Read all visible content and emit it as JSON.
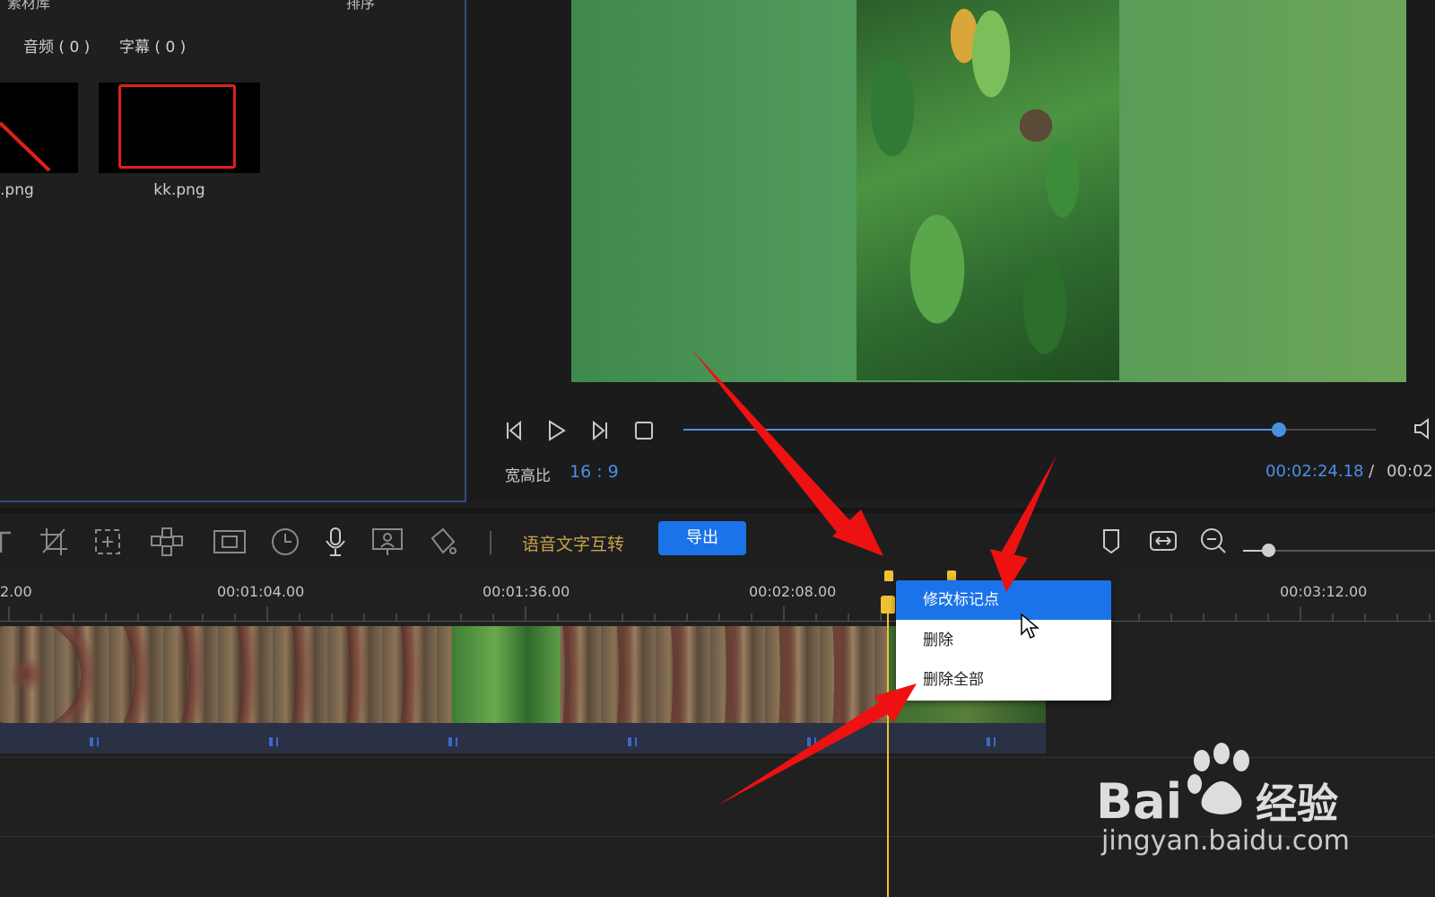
{
  "media": {
    "title": "素材库",
    "sort_label": "排序",
    "tabs": [
      {
        "label": "音频 ( 0 )"
      },
      {
        "label": "字幕 ( 0 )"
      }
    ],
    "items": [
      {
        "name": ".png"
      },
      {
        "name": "kk.png"
      }
    ]
  },
  "preview": {
    "aspect_label": "宽高比",
    "aspect_value": "16 : 9",
    "time_current": "00:02:24.18",
    "time_separator": "/",
    "time_total": "00:02:",
    "progress": 0.86
  },
  "toolbar": {
    "speech_text_label": "语音文字互转",
    "export_label": "导出"
  },
  "timeline": {
    "ticks": [
      "2.00",
      "00:01:04.00",
      "00:01:36.00",
      "00:02:08.00",
      "00:03:12.00"
    ]
  },
  "context_menu": {
    "items": [
      {
        "label": "修改标记点"
      },
      {
        "label": "删除"
      },
      {
        "label": "删除全部"
      }
    ]
  },
  "watermark": {
    "logo_text": "Bai du 经验",
    "url": "jingyan.baidu.com"
  },
  "colors": {
    "accent": "#1a73e8",
    "progress": "#4a90e2",
    "marker": "#f0c232",
    "annotation_arrow": "#ee1111"
  }
}
